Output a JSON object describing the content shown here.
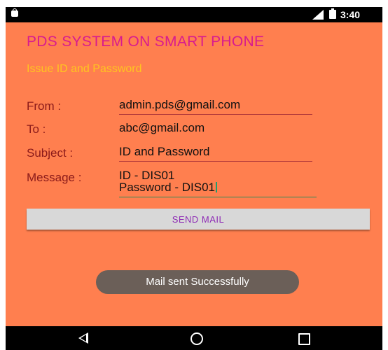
{
  "status_bar": {
    "time": "3:40",
    "left_icon": "android-debug-icon",
    "signal_icon": "signal-icon",
    "battery_icon": "battery-icon"
  },
  "app": {
    "title": "PDS SYSTEM ON SMART PHONE",
    "subtitle": "Issue ID and Password"
  },
  "form": {
    "from_label": "From :",
    "from_value": "admin.pds@gmail.com",
    "to_label": "To :",
    "to_value": "abc@gmail.com",
    "subject_label": "Subject :",
    "subject_value": "ID and Password",
    "message_label": "Message :",
    "message_line1": "ID - DIS01",
    "message_line2": "Password - DIS01"
  },
  "send_button_label": "SEND MAIL",
  "toast": "Mail sent Successfully",
  "nav_bar": {
    "back_icon": "back-icon",
    "home_icon": "home-icon",
    "recents_icon": "recents-icon"
  },
  "colors": {
    "background": "#ff7f4f",
    "title": "#d81b8f",
    "subtitle": "#ffc51f",
    "label": "#8b1a1a",
    "button_text": "#8e2bb5"
  }
}
